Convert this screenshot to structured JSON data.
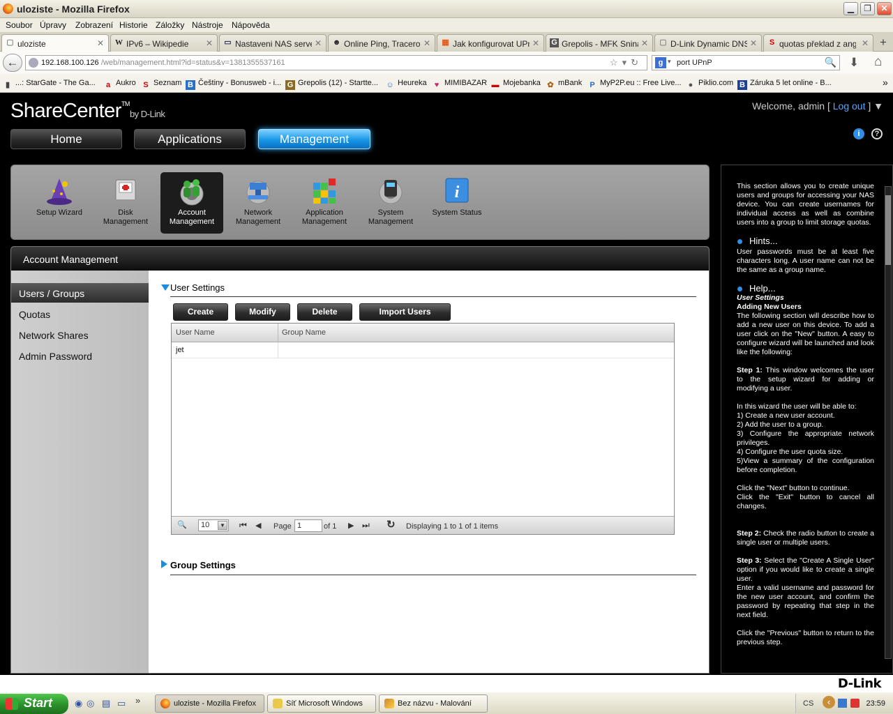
{
  "window": {
    "title": "uloziste - Mozilla Firefox",
    "minimize": "▁",
    "restore": "❐",
    "close": "✕"
  },
  "menu": [
    "Soubor",
    "Úpravy",
    "Zobrazení",
    "Historie",
    "Záložky",
    "Nástroje",
    "Nápověda"
  ],
  "tabs": [
    {
      "label": "uloziste",
      "icon": "page-icon",
      "icon_glyph": "▢"
    },
    {
      "label": "IPv6 – Wikipedie",
      "icon": "wikipedia-icon",
      "icon_glyph": "W"
    },
    {
      "label": "Nastaveni NAS serve...",
      "icon": "monitor-icon",
      "icon_glyph": "▭"
    },
    {
      "label": "Online Ping, Tracerou...",
      "icon": "penguin-icon",
      "icon_glyph": "☻"
    },
    {
      "label": "Jak konfigurovat UPn...",
      "icon": "windows-icon",
      "icon_glyph": "▦"
    },
    {
      "label": "Grepolis - MFK Snina",
      "icon": "grepolis-icon",
      "icon_glyph": "G"
    },
    {
      "label": "D-Link Dynamic DNS :...",
      "icon": "page-icon",
      "icon_glyph": "▢"
    },
    {
      "label": "quotas překlad z angli...",
      "icon": "seznam-icon",
      "icon_glyph": "S"
    }
  ],
  "tab_close": "✕",
  "new_tab": "+",
  "nav": {
    "back": "←",
    "url_host": "192.168.100.126",
    "url_path": "/web/management.html?id=status&v=1381355537161",
    "url_icons": "☆▾↻",
    "search_value": "port UPnP",
    "search_engine": "g",
    "download": "⬇",
    "home": "⌂",
    "magnifier": "🔍"
  },
  "bookmarks": [
    {
      "label": "...: StarGate - The Ga...",
      "glyph": "▮",
      "color": "#444444"
    },
    {
      "label": "Aukro",
      "glyph": "a",
      "color": "#cc0000"
    },
    {
      "label": "Seznam",
      "glyph": "S",
      "color": "#cc0000"
    },
    {
      "label": "Češtiny - Bonusweb - i...",
      "glyph": "B",
      "color": "#2a6fc9"
    },
    {
      "label": "Grepolis (12) - Startte...",
      "glyph": "G",
      "color": "#8a6a20"
    },
    {
      "label": "Heureka",
      "glyph": "☺",
      "color": "#2a6fc9"
    },
    {
      "label": "MIMIBAZAR",
      "glyph": "♥",
      "color": "#c0306a"
    },
    {
      "label": "Mojebanka",
      "glyph": "▬",
      "color": "#cc0000"
    },
    {
      "label": "mBank",
      "glyph": "✿",
      "color": "#b06010"
    },
    {
      "label": "MyP2P.eu :: Free Live...",
      "glyph": "P",
      "color": "#2a6fc9"
    },
    {
      "label": "Piklio.com",
      "glyph": "●",
      "color": "#555555"
    },
    {
      "label": "Záruka 5 let online - B...",
      "glyph": "B",
      "color": "#1e3f9a"
    }
  ],
  "bookmarks_more": "»",
  "header": {
    "logo": "ShareCenter",
    "logo_tm": "TM",
    "logo_by": "by D-Link",
    "welcome": "Welcome, admin [",
    "logout": " Log out ",
    "welcome_end": "] ▼",
    "info": "i",
    "help": "?"
  },
  "main_tabs": [
    "Home",
    "Applications",
    "Management"
  ],
  "icon_bar": [
    {
      "line1": "Setup Wizard",
      "line2": ""
    },
    {
      "line1": "Disk",
      "line2": "Management"
    },
    {
      "line1": "Account",
      "line2": "Management"
    },
    {
      "line1": "Network",
      "line2": "Management"
    },
    {
      "line1": "Application",
      "line2": "Management"
    },
    {
      "line1": "System",
      "line2": "Management"
    },
    {
      "line1": "System Status",
      "line2": ""
    }
  ],
  "panel_title": "Account Management",
  "side_menu": [
    "Users / Groups",
    "Quotas",
    "Network Shares",
    "Admin Password"
  ],
  "user_settings": {
    "title": "User Settings",
    "buttons": [
      "Create",
      "Modify",
      "Delete",
      "Import Users"
    ],
    "columns": [
      "User Name",
      "Group Name"
    ],
    "rows": [
      {
        "user": "jet",
        "group": ""
      }
    ],
    "pager": {
      "page_size": "10",
      "page_label": "Page",
      "page": "1",
      "of": "of 1",
      "display": "Displaying 1 to 1 of 1 items",
      "search_glyph": "🔍",
      "select_arrow": "▼",
      "first_glyph": "⏮",
      "prev_glyph": "◀",
      "next_glyph": "▶",
      "last_glyph": "⏭",
      "refresh_glyph": "↻"
    }
  },
  "group_settings": {
    "title": "Group Settings"
  },
  "help": {
    "intro": "This section allows you to create unique users and groups for accessing your NAS device. You can create usernames for individual access as well as combine users into a group to limit storage quotas.",
    "hints_title": "Hints...",
    "hints": "User passwords must be at least five characters long. A user name can not be the same as a group name.",
    "help_title": "Help...",
    "help_sub1": "User Settings",
    "help_sub2": "Adding New Users",
    "p1": "The following section will describe how to add a new user on this device. To add a user click on the \"New\" button. A easy to configure wizard will be launched and look like the following:",
    "step1_label": "Step 1:",
    "step1": " This window welcomes the user to the setup wizard for adding or modifying a user.",
    "wizard_intro": "In this wizard the user will be able to:",
    "list1": "1) Create a new user account.",
    "list2": "2) Add the user to a group.",
    "list3": "3) Configure the appropriate network privileges.",
    "list4": "4) Configure the user quota size.",
    "list5": "5)View a summary of the configuration before completion.",
    "next_text": "Click the \"Next\" button to continue.",
    "exit_text": "Click the \"Exit\" button to cancel all changes.",
    "step2_label": "Step 2:",
    "step2": " Check the radio button to create a single user or multiple users.",
    "step3_label": "Step 3:",
    "step3": " Select the \"Create A Single User\" option if you would like to create a single user.",
    "step3b": "Enter a valid username and password for the new user account, and confirm the password by repeating that step in the next field.",
    "prev_text": "Click the \"Previous\" button to return to the previous step."
  },
  "footer_brand": "D-Link",
  "taskbar": {
    "start": "Start",
    "quick_glyphs": [
      "◉",
      "◎",
      "▤",
      "▭",
      "»"
    ],
    "tasks": [
      "uloziste - Mozilla Firefox",
      "Síť Microsoft Windows",
      "Bez názvu - Malování"
    ],
    "lang": "CS",
    "tray_arrow": "‹",
    "time": "23:59"
  }
}
